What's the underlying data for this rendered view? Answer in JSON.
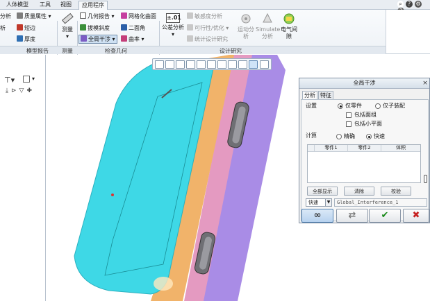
{
  "tabs": [
    "人体模型",
    "工具",
    "视图",
    "应用程序"
  ],
  "active_tab": "应用程序",
  "ribbon": {
    "model_report_items": [
      "质量属性",
      "短边",
      "厚度"
    ],
    "model_report_partial": "分析",
    "model_report_partial2": "析",
    "model_report_label": "模型报告",
    "measure_label": "测量",
    "measure_group_label": "测量",
    "inspect_items_left": [
      "几何报告",
      "拔模斜度",
      "全局干涉"
    ],
    "inspect_items_right": [
      "网格化曲面",
      "二面角",
      "曲率"
    ],
    "inspect_label": "检查几何",
    "tolerance_value": "±.01",
    "tolerance_label": "公差分析",
    "design_items": [
      "敏感度分析",
      "可行性/优化",
      "统计设计研究"
    ],
    "design_big": [
      "运动分析",
      "Simulate 分析",
      "电气间隙"
    ],
    "design_label": "设计研究"
  },
  "dialog": {
    "title": "全局干涉",
    "tabs": [
      "分析",
      "特征"
    ],
    "settings_label": "设置",
    "settings_options": [
      "仅零件",
      "仅子装配"
    ],
    "settings_selected": "仅零件",
    "checkboxes": [
      "包括面组",
      "包括小平面"
    ],
    "compute_label": "计算",
    "compute_options": [
      "精确",
      "快速"
    ],
    "compute_selected": "快速",
    "table_headers": [
      "零件1",
      "零件2",
      "体积"
    ],
    "buttons": [
      "全部显示",
      "清除",
      "校验"
    ],
    "mode_value": "快速",
    "name_value": "Global_Interference_1"
  },
  "colors": {
    "phone_body": "#3ed8e6",
    "phone_rim": "#f1b36a",
    "phone_side": "#a98ce6",
    "ok_green": "#1a8a1a",
    "cancel_red": "#c62020"
  }
}
